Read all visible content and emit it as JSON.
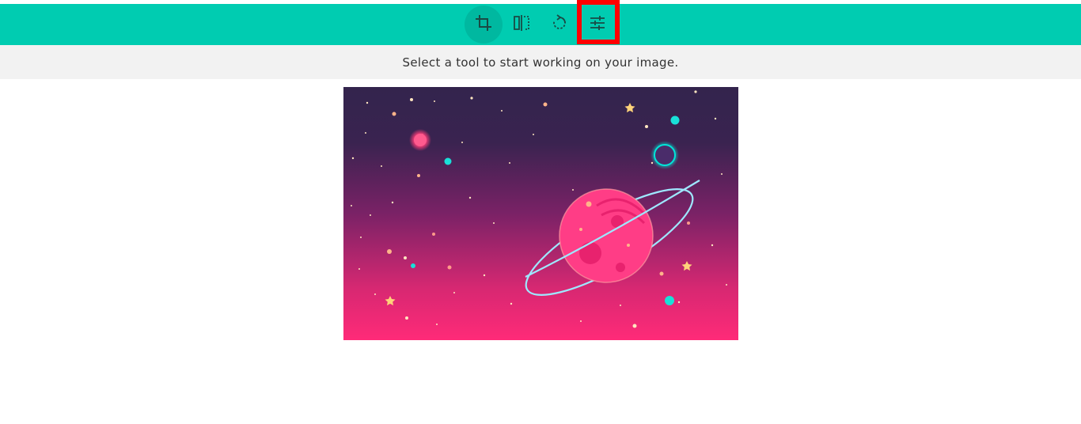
{
  "toolbar": {
    "background": "#00ccb1",
    "tools": [
      {
        "name": "crop",
        "icon": "crop-icon",
        "active": true
      },
      {
        "name": "flip",
        "icon": "flip-icon",
        "active": false
      },
      {
        "name": "rotate",
        "icon": "rotate-icon",
        "active": false
      },
      {
        "name": "adjust",
        "icon": "sliders-icon",
        "active": false,
        "highlighted": true
      }
    ],
    "highlight_color": "#ff0000"
  },
  "hint": {
    "text": "Select a tool to start working on your image."
  },
  "canvas": {
    "image_description_icon": "space-planet-illustration",
    "colors": {
      "sky_top": "#33244d",
      "sky_mid": "#7a2266",
      "sky_bottom": "#ff2a78",
      "planet": "#ff3d86",
      "ring": "#9ee8ff",
      "moon_glow": "#00e5d8"
    }
  }
}
